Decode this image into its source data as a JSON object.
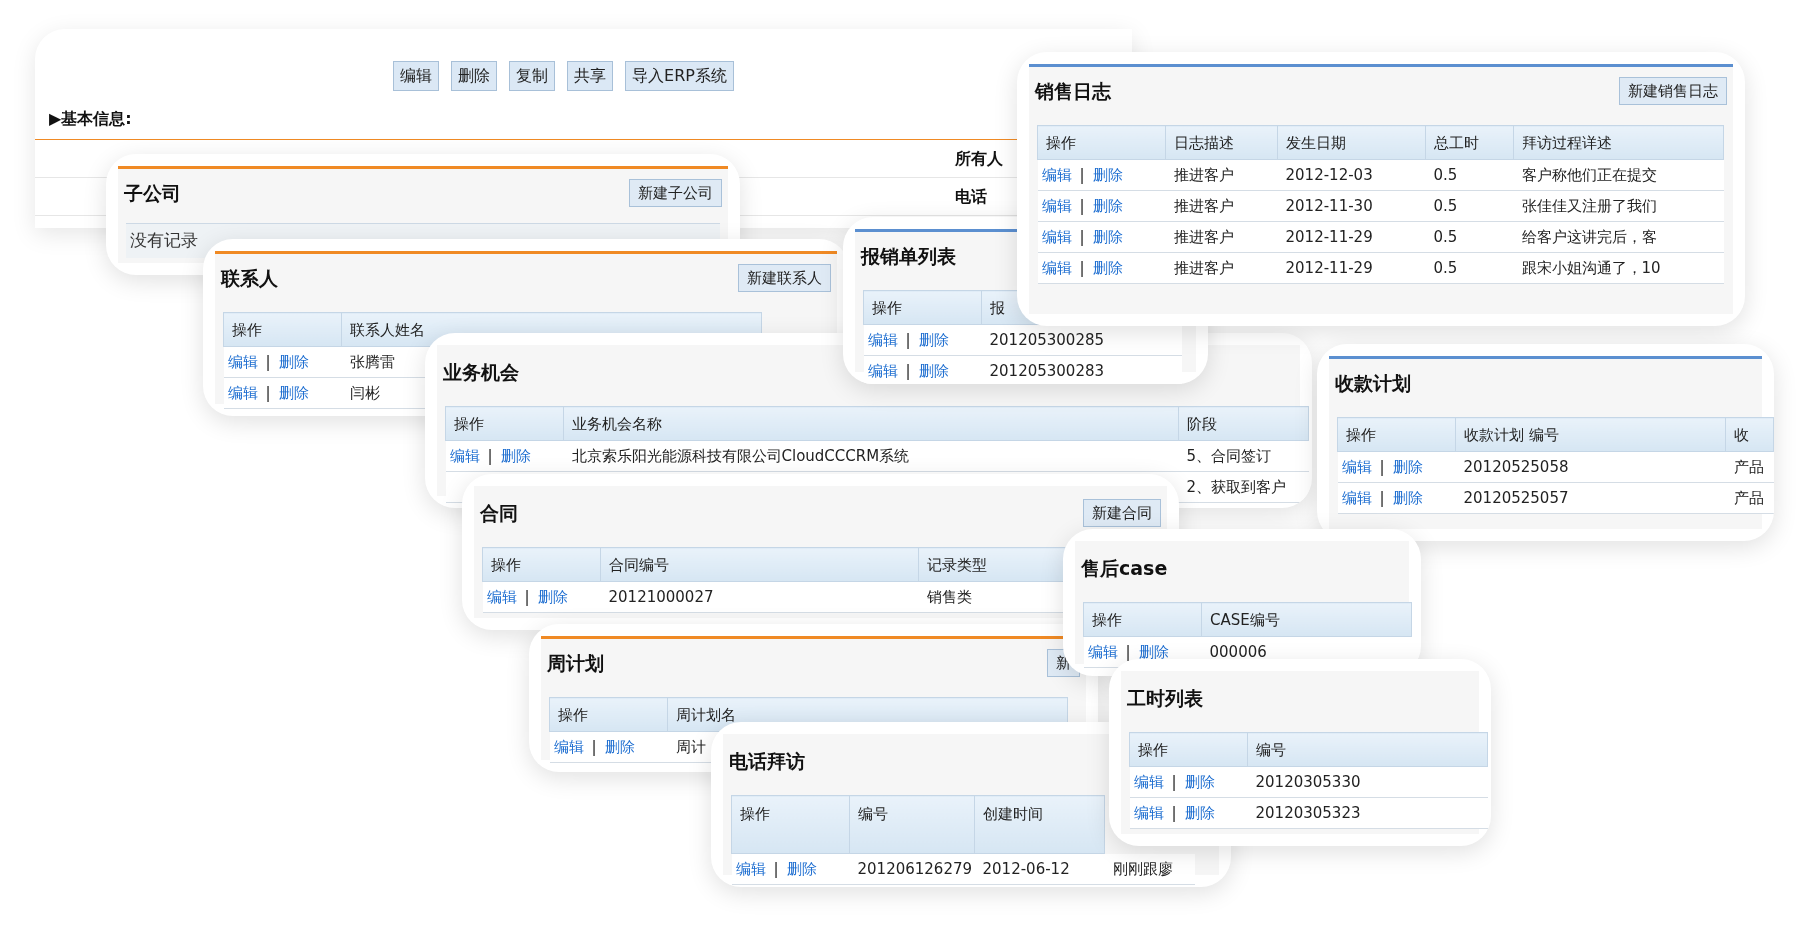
{
  "main_record": {
    "buttons": [
      "编辑",
      "删除",
      "复制",
      "共享",
      "导入ERP系统"
    ],
    "section": "▶基本信息:",
    "fields": [
      {
        "label": "所有人"
      },
      {
        "label": "电话"
      }
    ]
  },
  "cards": [
    {
      "title": "子公司",
      "color": "#f08a24",
      "button": "新建子公司",
      "empty_text": "没有记录"
    },
    {
      "title": "联系人",
      "color": "#f08a24",
      "button": "新建联系人",
      "action_column": "操作",
      "columns": [
        "联系人姓名"
      ],
      "rows": [
        {
          "edit": "编辑",
          "sep": "|",
          "delete": "删除",
          "cells": [
            "张腾雷"
          ]
        },
        {
          "edit": "编辑",
          "sep": "|",
          "delete": "删除",
          "cells": [
            "闫彬"
          ]
        }
      ]
    },
    {
      "title": "业务机会",
      "action_column": "操作",
      "columns": [
        "业务机会名称",
        "阶段"
      ],
      "rows": [
        {
          "edit": "编辑",
          "sep": "|",
          "delete": "删除",
          "cells": [
            "北京索乐阳光能源科技有限公司CloudCCCRM系统",
            "5、合同签订"
          ]
        },
        {
          "cells": [
            "",
            "2、获取到客户"
          ]
        }
      ]
    },
    {
      "title": "报销单列表",
      "color": "#5b8fd0",
      "action_column": "操作",
      "columns": [
        "报"
      ],
      "rows": [
        {
          "edit": "编辑",
          "sep": "|",
          "delete": "删除",
          "cells": [
            "201205300285"
          ]
        },
        {
          "edit": "编辑",
          "sep": "|",
          "delete": "删除",
          "cells": [
            "201205300283"
          ]
        }
      ]
    },
    {
      "title": "销售日志",
      "color": "#5b8fd0",
      "button": "新建销售日志",
      "action_column": "操作",
      "columns": [
        "日志描述",
        "发生日期",
        "总工时",
        "拜访过程详述"
      ],
      "rows": [
        {
          "edit": "编辑",
          "sep": "|",
          "delete": "删除",
          "cells": [
            "推进客户",
            "2012-12-03",
            "0.5",
            "客户称他们正在提交"
          ]
        },
        {
          "edit": "编辑",
          "sep": "|",
          "delete": "删除",
          "cells": [
            "推进客户",
            "2012-11-30",
            "0.5",
            "张佳佳又注册了我们"
          ]
        },
        {
          "edit": "编辑",
          "sep": "|",
          "delete": "删除",
          "cells": [
            "推进客户",
            "2012-11-29",
            "0.5",
            "给客户这讲完后，客"
          ]
        },
        {
          "edit": "编辑",
          "sep": "|",
          "delete": "删除",
          "cells": [
            "推进客户",
            "2012-11-29",
            "0.5",
            "跟宋小姐沟通了，10"
          ]
        }
      ]
    },
    {
      "title": "收款计划",
      "color": "#5b8fd0",
      "action_column": "操作",
      "columns": [
        "收款计划 编号",
        "收"
      ],
      "rows": [
        {
          "edit": "编辑",
          "sep": "|",
          "delete": "删除",
          "cells": [
            "20120525058",
            "产品"
          ]
        },
        {
          "edit": "编辑",
          "sep": "|",
          "delete": "删除",
          "cells": [
            "20120525057",
            "产品"
          ]
        }
      ]
    },
    {
      "title": "合同",
      "button": "新建合同",
      "action_column": "操作",
      "columns": [
        "合同编号",
        "记录类型"
      ],
      "rows": [
        {
          "edit": "编辑",
          "sep": "|",
          "delete": "删除",
          "cells": [
            "20121000027",
            "销售类"
          ]
        }
      ]
    },
    {
      "title": "售后case",
      "action_column": "操作",
      "columns": [
        "CASE编号"
      ],
      "rows": [
        {
          "edit": "编辑",
          "sep": "|",
          "delete": "删除",
          "cells": [
            "000006"
          ]
        }
      ]
    },
    {
      "title": "周计划",
      "color": "#f08a24",
      "button": "新",
      "action_column": "操作",
      "columns": [
        "周计划名"
      ],
      "rows": [
        {
          "edit": "编辑",
          "sep": "|",
          "delete": "删除",
          "cells": [
            "周计"
          ]
        }
      ]
    },
    {
      "title": "电话拜访",
      "action_column": "操作",
      "columns": [
        "编号",
        "创建时间"
      ],
      "tall_header": true,
      "rows": [
        {
          "edit": "编辑",
          "sep": "|",
          "delete": "删除",
          "cells": [
            "201206126279",
            "2012-06-12",
            "刚刚跟廖"
          ]
        }
      ]
    },
    {
      "title": "工时列表",
      "action_column": "操作",
      "columns": [
        "编号"
      ],
      "rows": [
        {
          "edit": "编辑",
          "sep": "|",
          "delete": "删除",
          "cells": [
            "20120305330"
          ]
        },
        {
          "edit": "编辑",
          "sep": "|",
          "delete": "删除",
          "cells": [
            "20120305323"
          ]
        }
      ]
    }
  ]
}
